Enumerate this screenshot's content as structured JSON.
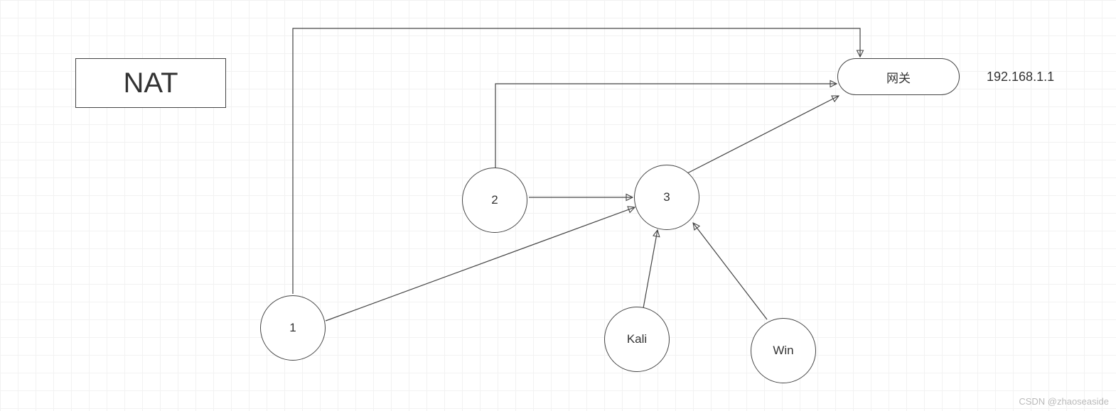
{
  "diagram": {
    "title": "NAT",
    "gateway": {
      "label": "网关",
      "ip": "192.168.1.1"
    },
    "nodes": {
      "n1": "1",
      "n2": "2",
      "n3": "3",
      "kali": "Kali",
      "win": "Win"
    },
    "watermark": "CSDN @zhaoseaside",
    "edges": [
      {
        "from": "n1",
        "to": "gateway"
      },
      {
        "from": "n2",
        "to": "gateway"
      },
      {
        "from": "n3",
        "to": "gateway"
      },
      {
        "from": "n1",
        "to": "n3"
      },
      {
        "from": "n2",
        "to": "n3"
      },
      {
        "from": "kali",
        "to": "n3"
      },
      {
        "from": "win",
        "to": "n3"
      }
    ]
  }
}
